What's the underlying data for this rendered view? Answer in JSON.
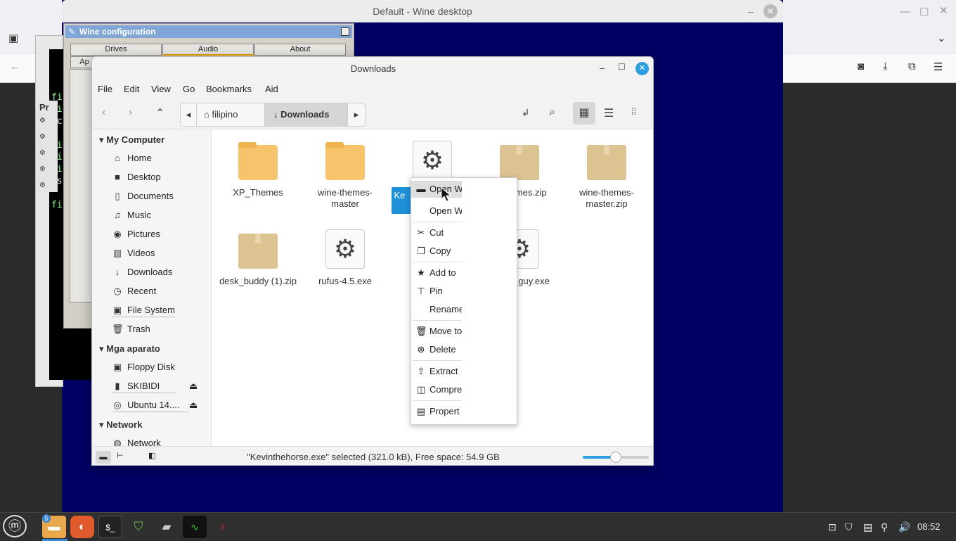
{
  "wine_desktop": {
    "title": "Default - Wine desktop"
  },
  "wine_config": {
    "title": "Wine configuration",
    "tabs": [
      "Drives",
      "Audio",
      "About"
    ],
    "partial_tab": "Ap"
  },
  "terminal": {
    "lines": [
      "fi",
      "fi",
      "lc",
      "",
      "fi",
      "fi",
      "fi",
      "Us",
      "",
      "fi"
    ]
  },
  "behind_labels": {
    "pr": "Pr",
    "fi": "Fi"
  },
  "file_manager": {
    "title": "Downloads",
    "menu": [
      "File",
      "Edit",
      "View",
      "Go",
      "Bookmarks",
      "Aid"
    ],
    "breadcrumb": {
      "home": "filipino",
      "current": "Downloads"
    },
    "sidebar": {
      "sections": [
        {
          "title": "My Computer",
          "items": [
            "Home",
            "Desktop",
            "Documents",
            "Music",
            "Pictures",
            "Videos",
            "Downloads",
            "Recent",
            "File System",
            "Trash"
          ]
        },
        {
          "title": "Mga aparato",
          "items": [
            "Floppy Disk",
            "SKIBIDI",
            "Ubuntu 14...."
          ]
        },
        {
          "title": "Network",
          "items": [
            "Network"
          ]
        }
      ]
    },
    "files": [
      {
        "name": "XP_Themes",
        "type": "folder"
      },
      {
        "name": "wine-themes-master",
        "type": "folder"
      },
      {
        "name": "Ke",
        "type": "exe",
        "selected": true
      },
      {
        "name": "Xf…emes.zip",
        "type": "zip"
      },
      {
        "name": "wine-themes-master.zip",
        "type": "zip"
      },
      {
        "name": "desk_buddy (1).zip",
        "type": "zip"
      },
      {
        "name": "rufus-4.5.exe",
        "type": "exe"
      },
      {
        "name": "family_guy.exe",
        "type": "exe"
      }
    ],
    "status": "\"Kevinthehorse.exe\" selected (321.0 kB), Free space: 54.9 GB",
    "zoom_level": 0.5
  },
  "context_menu": {
    "items": [
      "Open W",
      "Open W",
      "Cut",
      "Copy",
      "Add to",
      "Pin",
      "Rename",
      "Move to",
      "Delete",
      "Extract",
      "Compre",
      "Propert"
    ]
  },
  "taskbar": {
    "clock": "08:52",
    "badge": "5"
  },
  "colors": {
    "selection": "#1e90d8",
    "wine_bg": "#000064",
    "folder": "#f7c46c"
  }
}
